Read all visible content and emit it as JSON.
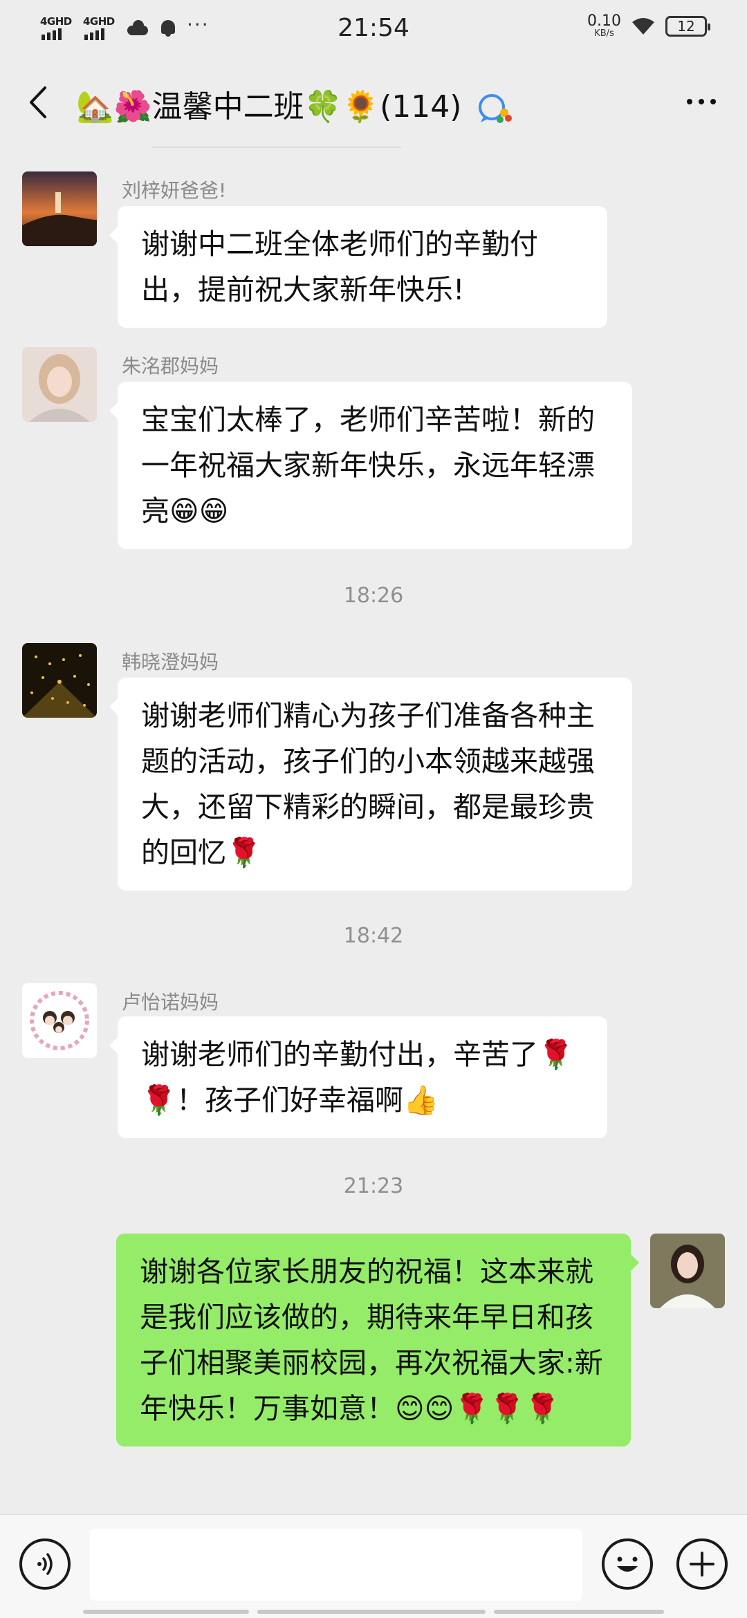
{
  "status_bar": {
    "net1": "4GHD",
    "net2": "4GHD",
    "more": "···",
    "time": "21:54",
    "speed_value": "0.10",
    "speed_unit": "KB/s",
    "battery": "12"
  },
  "header": {
    "title": "🏡🌺温馨中二班🍀🌻(114)",
    "back_icon": "chevron-left-icon",
    "more_icon": "more-dots-icon"
  },
  "messages": [
    {
      "type": "incoming",
      "sender": "刘梓妍爸爸!",
      "text": "谢谢中二班全体老师们的辛勤付出，提前祝大家新年快乐!",
      "avatar": "lighthouse-sunset-avatar"
    },
    {
      "type": "incoming",
      "sender": "朱洺郡妈妈",
      "text": "宝宝们太棒了，老师们辛苦啦！新的一年祝福大家新年快乐，永远年轻漂亮😁😁",
      "avatar": "woman-portrait-avatar"
    },
    {
      "type": "time",
      "text": "18:26"
    },
    {
      "type": "incoming",
      "sender": "韩晓澄妈妈",
      "text": "谢谢老师们精心为孩子们准备各种主题的活动，孩子们的小本领越来越强大，还留下精彩的瞬间，都是最珍贵的回忆🌹",
      "avatar": "golden-lights-avatar"
    },
    {
      "type": "time",
      "text": "18:42"
    },
    {
      "type": "incoming",
      "sender": "卢怡诺妈妈",
      "text": "谢谢老师们的辛勤付出，辛苦了🌹🌹！孩子们好幸福啊👍",
      "avatar": "family-cartoon-avatar"
    },
    {
      "type": "time",
      "text": "21:23"
    },
    {
      "type": "outgoing",
      "text": "谢谢各位家长朋友的祝福！这本来就是我们应该做的，期待来年早日和孩子们相聚美丽校园，再次祝福大家:新年快乐！万事如意！😊😊🌹🌹🌹",
      "avatar": "self-portrait-avatar"
    }
  ],
  "input_bar": {
    "placeholder": "",
    "voice_icon": "voice-icon",
    "emoji_icon": "emoji-icon",
    "plus_icon": "plus-icon"
  },
  "colors": {
    "background": "#ededed",
    "outgoing_bubble": "#95ec69",
    "incoming_bubble": "#ffffff"
  }
}
